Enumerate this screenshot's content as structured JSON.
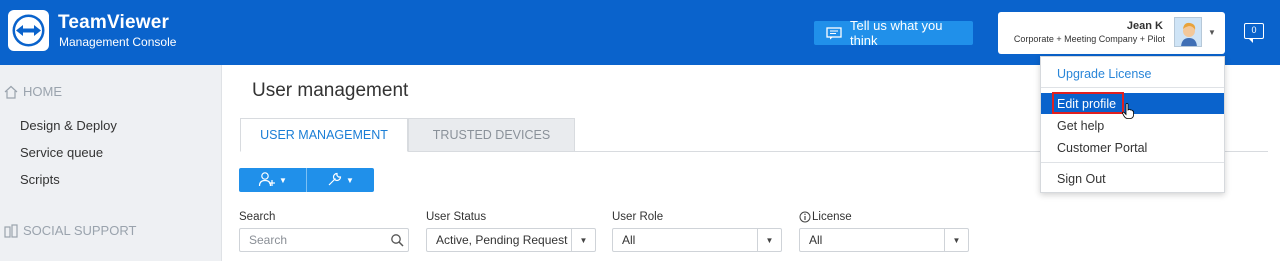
{
  "header": {
    "brand_title": "TeamViewer",
    "brand_subtitle": "Management Console",
    "feedback_label": "Tell us what you think",
    "user_name": "Jean K",
    "user_company": "Corporate + Meeting Company + Pilot",
    "notifications_count": "0",
    "accent_color": "#0a63cc"
  },
  "sidebar": {
    "sections": [
      {
        "label": "HOME",
        "icon": "home-icon"
      },
      {
        "label": "SOCIAL SUPPORT",
        "icon": "social-icon"
      }
    ],
    "items": [
      "Design & Deploy",
      "Service queue",
      "Scripts"
    ]
  },
  "main": {
    "page_title": "User management",
    "tabs": [
      {
        "label": "USER MANAGEMENT",
        "active": true
      },
      {
        "label": "TRUSTED DEVICES",
        "active": false
      }
    ],
    "toolbar": {
      "add_user_icon": "add-user-icon",
      "tools_icon": "wrench-icon"
    },
    "filters": {
      "search_label": "Search",
      "search_placeholder": "Search",
      "status_label": "User Status",
      "status_value": "Active, Pending Request",
      "role_label": "User Role",
      "role_value": "All",
      "license_label": "License",
      "license_value": "All"
    }
  },
  "user_menu": {
    "items": [
      "Upgrade License",
      "Edit profile",
      "Get help",
      "Customer Portal",
      "Sign Out"
    ],
    "highlighted": "Edit profile"
  }
}
